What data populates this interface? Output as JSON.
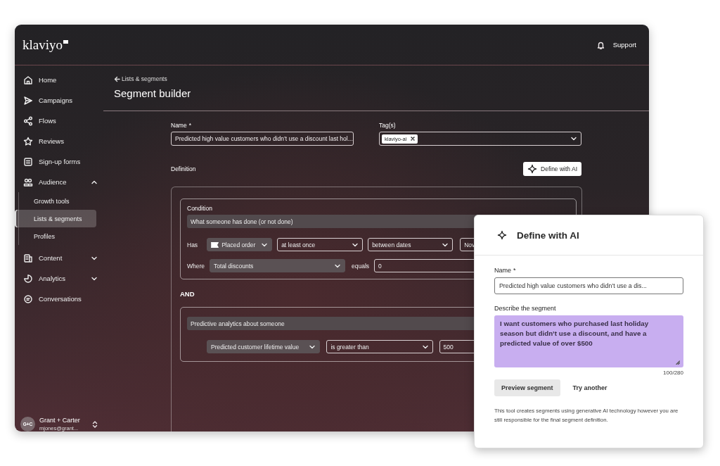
{
  "app": {
    "logo": "klaviyo",
    "support": "Support"
  },
  "sidebar": {
    "items": [
      {
        "label": "Home",
        "selected": false
      },
      {
        "label": "Campaigns",
        "selected": false
      },
      {
        "label": "Flows",
        "selected": false
      },
      {
        "label": "Reviews",
        "selected": false
      },
      {
        "label": "Sign-up forms",
        "selected": false
      },
      {
        "label": "Audience",
        "selected": false,
        "expanded": true,
        "children": [
          {
            "label": "Growth tools",
            "selected": false
          },
          {
            "label": "Lists & segments",
            "selected": true
          },
          {
            "label": "Profiles",
            "selected": false
          }
        ]
      },
      {
        "label": "Content",
        "selected": false,
        "expanded": false
      },
      {
        "label": "Analytics",
        "selected": false,
        "expanded": false
      },
      {
        "label": "Conversations",
        "selected": false
      }
    ],
    "account": {
      "initials": "G+C",
      "name": "Grant + Carter",
      "email": "mjones@grant..."
    }
  },
  "page": {
    "back_link": "Lists & segments",
    "title": "Segment builder"
  },
  "form": {
    "name_label": "Name",
    "required_mark": "*",
    "name_value": "Predicted high value customers who didn’t use a discount last hol...",
    "tags_label": "Tag(s)",
    "tags": [
      "klaviyo-ai"
    ],
    "definition_label": "Definition",
    "define_ai_button": "Define with AI"
  },
  "conditions": [
    {
      "kind": "event",
      "heading": "Condition",
      "type": "What someone has done (or not done)",
      "has_label": "Has",
      "metric": "Placed order",
      "frequency": "at least once",
      "timeframe": "between dates",
      "date": "Nov",
      "where_label": "Where",
      "property": "Total discounts",
      "operator": "equals",
      "value": "0"
    },
    {
      "kind": "predictive",
      "type": "Predictive analytics about someone",
      "metric": "Predicted customer lifetime value",
      "operator": "is greater than",
      "value": "500"
    }
  ],
  "joiner": "AND",
  "ai_panel": {
    "title": "Define with AI",
    "name_label": "Name",
    "required_mark": "*",
    "name_value": "Predicted high value customers who didn’t use a dis...",
    "describe_label": "Describe the segment",
    "description": "I want customers who purchased last holiday season but didn’t use a discount, and have a predicted value of over $500",
    "counter": "100/280",
    "preview_button": "Preview segment",
    "try_button": "Try another",
    "disclaimer": "This tool creates segments using generative AI technology however you are still responsible for the final segment definition."
  }
}
